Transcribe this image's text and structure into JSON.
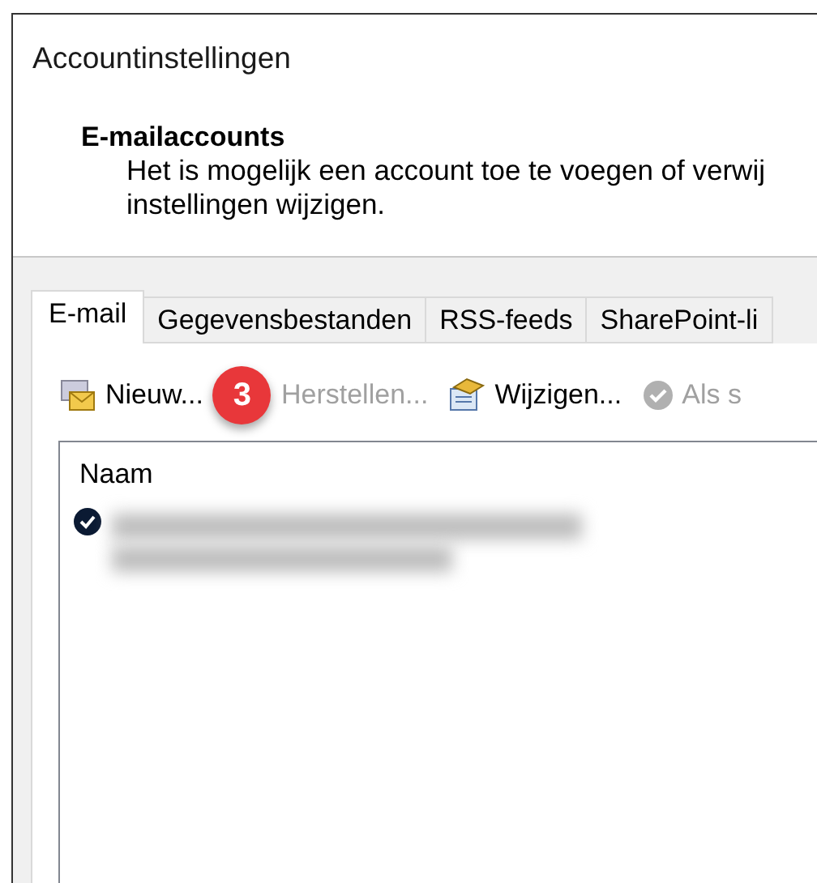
{
  "window": {
    "title": "Accountinstellingen"
  },
  "header": {
    "heading": "E-mailaccounts",
    "description_lines": [
      "Het is mogelijk een account toe te voegen of verwij",
      "instellingen wijzigen."
    ]
  },
  "tabs": [
    {
      "label": "E-mail",
      "selected": true
    },
    {
      "label": "Gegevensbestanden",
      "selected": false
    },
    {
      "label": "RSS-feeds",
      "selected": false
    },
    {
      "label": "SharePoint-li",
      "selected": false
    }
  ],
  "toolbar": [
    {
      "label": "Nieuw...",
      "kind": "new",
      "disabled": false
    },
    {
      "label": "Herstellen...",
      "kind": "repair",
      "disabled": true
    },
    {
      "label": "Wijzigen...",
      "kind": "change",
      "disabled": false
    },
    {
      "label": "Als s",
      "kind": "default",
      "disabled": true
    }
  ],
  "step_badge": "3",
  "account_list": {
    "columns": [
      "Naam"
    ],
    "rows": [
      {
        "default": true
      }
    ]
  }
}
